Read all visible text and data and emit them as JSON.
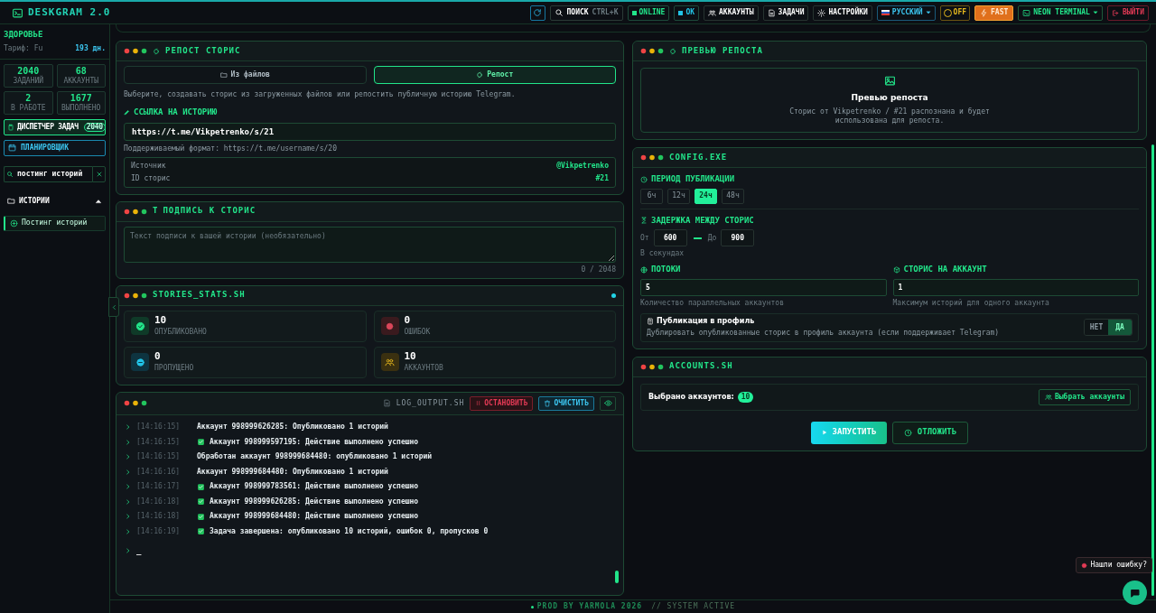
{
  "app": {
    "title": "DESKGRAM 2.0"
  },
  "toolbar": [
    {
      "kind": "refresh"
    },
    {
      "kind": "search",
      "label": "ПОИСК",
      "shortcut": "CTRL+K"
    },
    {
      "kind": "status",
      "label": "ONLINE",
      "color": "#22e58a"
    },
    {
      "kind": "status",
      "label": "OK",
      "color": "#22c3e6"
    },
    {
      "kind": "accounts",
      "label": "АККАУНТЫ"
    },
    {
      "kind": "tasks",
      "label": "ЗАДАЧИ"
    },
    {
      "kind": "settings",
      "label": "НАСТРОЙКИ"
    },
    {
      "kind": "language",
      "label": "РУССКИЙ"
    },
    {
      "kind": "toggle",
      "label": "OFF",
      "on": false
    },
    {
      "kind": "mode",
      "label": "FAST",
      "on": true
    },
    {
      "kind": "theme",
      "label": "NEON TERMINAL"
    },
    {
      "kind": "logout",
      "label": "ВЫЙТИ"
    }
  ],
  "sidebar": {
    "profile": "ЗДОРОВЬЕ",
    "tariff": "Тариф: Fu",
    "days": "193 дн.",
    "stats": [
      {
        "value": "2040",
        "label": "ЗАДАНИЙ"
      },
      {
        "value": "68",
        "label": "АККАУНТЫ"
      },
      {
        "value": "2",
        "label": "В РАБОТЕ"
      },
      {
        "value": "1677",
        "label": "ВЫПОЛНЕНО"
      }
    ],
    "dispatcher": {
      "label": "ДИСПЕТЧЕР ЗАДАЧ",
      "badge": "2040"
    },
    "scheduler": {
      "label": "ПЛАНИРОВЩИК"
    },
    "search": {
      "value": "постинг историй"
    },
    "tree": [
      {
        "label": "ИСТОРИИ",
        "expanded": true,
        "children": [
          {
            "label": "Постинг историй",
            "selected": true
          }
        ]
      }
    ]
  },
  "repost": {
    "title": "РЕПОСТ СТОРИС",
    "tabs": [
      {
        "kind": "files",
        "label": "Из файлов",
        "selected": false
      },
      {
        "kind": "repost",
        "label": "Репост",
        "selected": true
      }
    ],
    "description": "Выберите, создавать сторис из загруженных файлов или репостить публичную историю Telegram.",
    "link_label": "ССЫЛКА НА ИСТОРИЮ",
    "link_value": "https://t.me/Vikpetrenko/s/21",
    "link_hint": "Поддерживаемый формат: https://t.me/username/s/20",
    "info": [
      {
        "label": "Источник",
        "value": "@Vikpetrenko"
      },
      {
        "label": "ID сторис",
        "value": "#21"
      }
    ]
  },
  "caption": {
    "title_icon": "T",
    "title": "ПОДПИСЬ К СТОРИС",
    "placeholder": "Текст подписи к вашей истории (необязательно)",
    "counter": "0 / 2048"
  },
  "stats": {
    "title": "STORIES_STATS.SH",
    "items": [
      {
        "kind": "published",
        "value": "10",
        "label": "ОПУБЛИКОВАНО"
      },
      {
        "kind": "errors",
        "value": "0",
        "label": "ОШИБОК"
      },
      {
        "kind": "skipped",
        "value": "0",
        "label": "ПРОПУЩЕНО"
      },
      {
        "kind": "accounts",
        "value": "10",
        "label": "АККАУНТОВ"
      }
    ]
  },
  "log": {
    "title": "LOG_OUTPUT.SH",
    "stop": "ОСТАНОВИТЬ",
    "clear": "ОЧИСТИТЬ",
    "lines": [
      {
        "time": "[14:16:15]",
        "ok": false,
        "text": "Аккаунт 998999626285: Опубликовано 1 историй"
      },
      {
        "time": "[14:16:15]",
        "ok": true,
        "text": "Аккаунт 998999597195: Действие выполнено успешно"
      },
      {
        "time": "[14:16:15]",
        "ok": false,
        "text": "Обработан аккаунт 998999684480: опубликовано 1 историй"
      },
      {
        "time": "[14:16:16]",
        "ok": false,
        "text": "Аккаунт 998999684480: Опубликовано 1 историй"
      },
      {
        "time": "[14:16:17]",
        "ok": true,
        "text": "Аккаунт 998999783561: Действие выполнено успешно"
      },
      {
        "time": "[14:16:18]",
        "ok": true,
        "text": "Аккаунт 998999626285: Действие выполнено успешно"
      },
      {
        "time": "[14:16:18]",
        "ok": true,
        "text": "Аккаунт 998999684480: Действие выполнено успешно"
      },
      {
        "time": "[14:16:19]",
        "ok": true,
        "text": "Задача завершена: опубликовано 10 историй, ошибок 0, пропусков 0"
      }
    ],
    "cursor": "_"
  },
  "preview": {
    "title": "ПРЕВЬЮ РЕПОСТА",
    "heading": "Превью репоста",
    "text": "Сторис от Vikpetrenko / #21 распознана и будет использована для репоста."
  },
  "config": {
    "title": "CONFIG.EXE",
    "period_label": "ПЕРИОД ПУБЛИКАЦИИ",
    "periods": [
      {
        "label": "6ч",
        "selected": false
      },
      {
        "label": "12ч",
        "selected": false
      },
      {
        "label": "24ч",
        "selected": true
      },
      {
        "label": "48ч",
        "selected": false
      }
    ],
    "delay_label": "ЗАДЕРЖКА МЕЖДУ СТОРИС",
    "from_label": "От",
    "from": "600",
    "to_label": "До",
    "to": "900",
    "delay_hint": "В секундах",
    "threads": {
      "label": "ПОТОКИ",
      "value": "5",
      "hint": "Количество параллельных аккаунтов"
    },
    "per_account": {
      "label": "СТОРИС НА АККАУНТ",
      "value": "1",
      "hint": "Максимум историй для одного аккаунта"
    },
    "profile": {
      "title": "Публикация в профиль",
      "description": "Дублировать опубликованные сторис в профиль аккаунта (если поддерживает Telegram)",
      "options": [
        {
          "label": "НЕТ",
          "selected": false
        },
        {
          "label": "ДА",
          "selected": true
        }
      ]
    }
  },
  "accounts": {
    "title": "ACCOUNTS.SH",
    "label": "Выбрано аккаунтов:",
    "count": "10",
    "select": "Выбрать аккаунты"
  },
  "actions": {
    "start": "ЗАПУСТИТЬ",
    "delay": "ОТЛОЖИТЬ"
  },
  "footer": {
    "left": "PROD BY YARMOLA 2026",
    "right": "// SYSTEM ACTIVE"
  },
  "report": "Нашли ошибку?"
}
